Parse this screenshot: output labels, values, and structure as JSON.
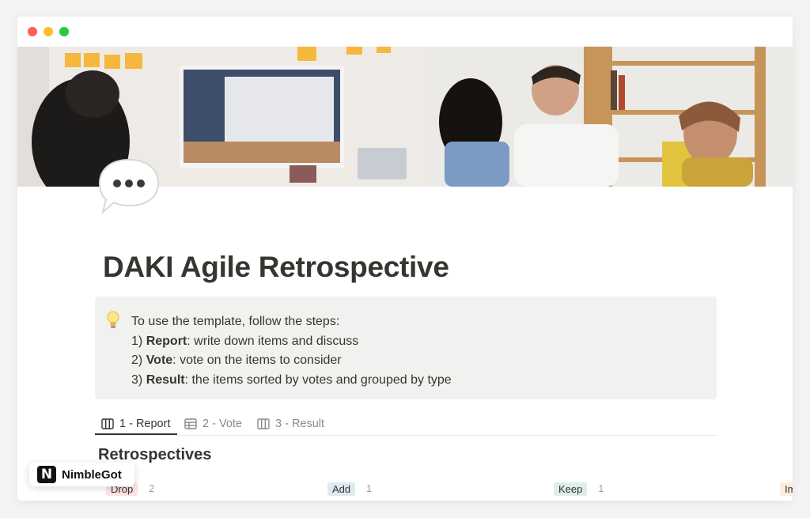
{
  "window": {
    "controls": [
      "close",
      "minimize",
      "maximize"
    ],
    "colors": {
      "close": "#ff5f57",
      "minimize": "#febc2e",
      "maximize": "#28c840"
    }
  },
  "cover": {
    "icon": "photo-of-team-meeting"
  },
  "page": {
    "icon": "speech-bubble-ellipsis-icon",
    "title": "DAKI Agile Retrospective"
  },
  "callout": {
    "icon": "lightbulb-icon",
    "intro": "To use the template, follow the steps:",
    "steps": [
      {
        "num": "1)",
        "bold": "Report",
        "rest": ": write down items and discuss"
      },
      {
        "num": "2)",
        "bold": "Vote",
        "rest": ": vote on the items to consider"
      },
      {
        "num": "3)",
        "bold": "Result",
        "rest": ": the items sorted by votes and grouped by type"
      }
    ]
  },
  "tabs": [
    {
      "label": "1 - Report",
      "icon": "board-icon",
      "active": true
    },
    {
      "label": "2 - Vote",
      "icon": "table-icon",
      "active": false
    },
    {
      "label": "3 - Result",
      "icon": "board-icon",
      "active": false
    }
  ],
  "section": {
    "title": "Retrospectives"
  },
  "columns": [
    {
      "label": "Drop",
      "count": "2",
      "color": "#fbe4e4"
    },
    {
      "label": "Add",
      "count": "1",
      "color": "#ddebf1"
    },
    {
      "label": "Keep",
      "count": "1",
      "color": "#ddedea"
    },
    {
      "label": "Improve",
      "count": "",
      "color": "#fbecdd"
    }
  ],
  "brand": {
    "logo_letter": "N",
    "name": "NimbleGot"
  }
}
